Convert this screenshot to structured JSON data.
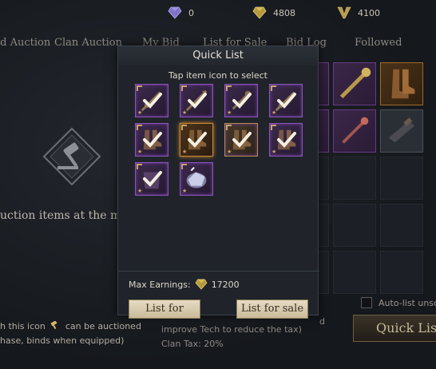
{
  "currency": [
    {
      "icon": "purple-diamond-icon",
      "value": "0"
    },
    {
      "icon": "gold-diamond-icon",
      "value": "4808"
    },
    {
      "icon": "v-emblem-icon",
      "value": "4100"
    }
  ],
  "tabs": [
    {
      "label": "ld Auction"
    },
    {
      "label": "Clan Auction"
    },
    {
      "label": "My Bid"
    },
    {
      "label": "List for Sale"
    },
    {
      "label": "Bid Log"
    },
    {
      "label": "Followed"
    }
  ],
  "left_panel": {
    "empty_text": "uction items at the m",
    "note_line1": "h this icon",
    "note_line1_b": "can be auctioned",
    "note_line2": "hase, binds when equipped)"
  },
  "tax": {
    "line1": "improve Tech to reduce the tax)",
    "line2": "Clan Tax: 20%",
    "fragment": "d"
  },
  "autolist": {
    "label": "Auto-list unsc"
  },
  "quick_list_button": {
    "label": "Quick List"
  },
  "modal": {
    "title": "Quick List",
    "subtitle": "Tap item icon to select",
    "items": [
      {
        "kind": "sword",
        "checked": true
      },
      {
        "kind": "spear",
        "checked": true
      },
      {
        "kind": "staff",
        "checked": true
      },
      {
        "kind": "sword",
        "checked": true
      },
      {
        "kind": "boots",
        "checked": true
      },
      {
        "kind": "boots",
        "checked": true
      },
      {
        "kind": "boots",
        "checked": true
      },
      {
        "kind": "boots",
        "checked": true
      },
      {
        "kind": "armor",
        "checked": true
      },
      {
        "kind": "crystal",
        "checked": false
      }
    ],
    "earnings_label": "Max Earnings:",
    "earnings_icon": "gold-diamond-icon",
    "earnings_value": "17200",
    "btn_left": "List for",
    "btn_right": "List for sale"
  },
  "colors": {
    "purple_frame": "#8c55b8",
    "gold_accent": "#c8a46a",
    "button_fill": "#e6dcc4"
  }
}
